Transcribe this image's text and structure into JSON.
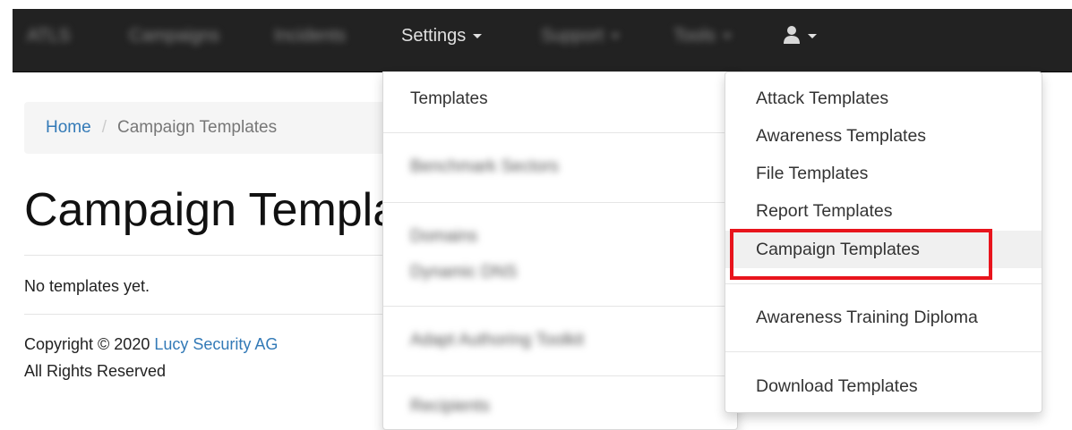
{
  "navbar": {
    "brand": "ATLS",
    "items": [
      {
        "label": "Campaigns"
      },
      {
        "label": "Incidents"
      },
      {
        "label": "Settings"
      },
      {
        "label": "Support"
      },
      {
        "label": "Tools"
      }
    ],
    "user_icon": "user-icon"
  },
  "breadcrumb": {
    "home": "Home",
    "separator": "/",
    "current": "Campaign Templates"
  },
  "page": {
    "title": "Campaign Templates",
    "empty_message": "No templates yet."
  },
  "footer": {
    "copyright_prefix": "Copyright © 2020",
    "company": "Lucy Security AG",
    "rights": "All Rights Reserved"
  },
  "settings_menu": {
    "items": [
      {
        "label": "Templates"
      },
      {
        "label": "Benchmark Sectors"
      },
      {
        "label": "Domains"
      },
      {
        "label": "Dynamic DNS"
      },
      {
        "label": "Adapt Authoring Toolkit"
      },
      {
        "label": "Recipients"
      }
    ]
  },
  "templates_menu": {
    "items": [
      {
        "label": "Attack Templates"
      },
      {
        "label": "Awareness Templates"
      },
      {
        "label": "File Templates"
      },
      {
        "label": "Report Templates"
      },
      {
        "label": "Campaign Templates"
      },
      {
        "label": "Awareness Training Diploma"
      },
      {
        "label": "Download Templates"
      }
    ],
    "highlighted_index": 4
  },
  "colors": {
    "navbar_bg": "#222222",
    "link": "#337ab7",
    "highlight_border": "#e8141c"
  }
}
